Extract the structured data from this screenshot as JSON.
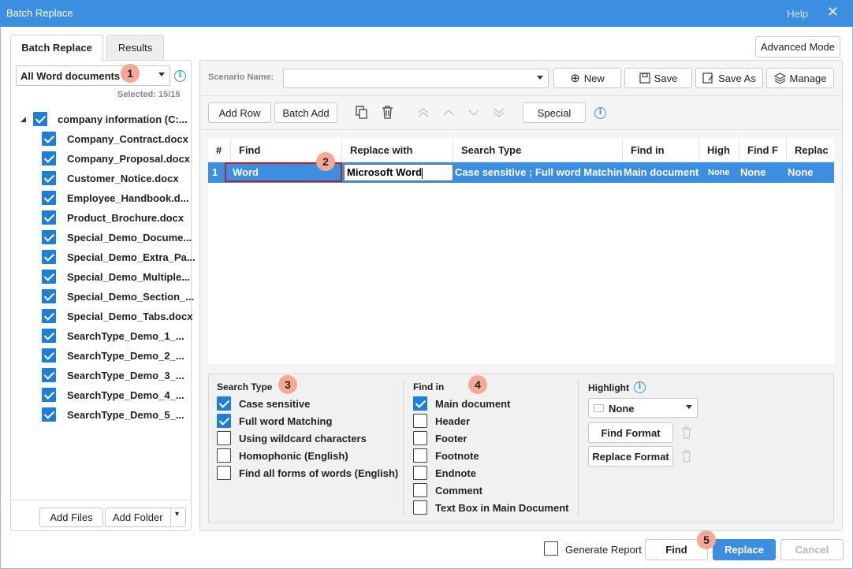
{
  "window": {
    "title": "Batch Replace",
    "help": "Help",
    "close": "✕"
  },
  "tabs": [
    {
      "label": "Batch Replace"
    },
    {
      "label": "Results"
    }
  ],
  "advanced_mode": "Advanced Mode",
  "left": {
    "filter": "All Word documents",
    "selected": "Selected: 15/15",
    "root": "company information (C:...",
    "files": [
      "Company_Contract.docx",
      "Company_Proposal.docx",
      "Customer_Notice.docx",
      "Employee_Handbook.d...",
      "Product_Brochure.docx",
      "Special_Demo_Docume...",
      "Special_Demo_Extra_Pa...",
      "Special_Demo_Multiple...",
      "Special_Demo_Section_...",
      "Special_Demo_Tabs.docx",
      "SearchType_Demo_1_...",
      "SearchType_Demo_2_...",
      "SearchType_Demo_3_...",
      "SearchType_Demo_4_...",
      "SearchType_Demo_5_..."
    ],
    "add_files": "Add Files",
    "add_folder": "Add Folder"
  },
  "scenario": {
    "label": "Scenario Name:",
    "value": "",
    "new": "New",
    "save": "Save",
    "save_as": "Save As",
    "manage": "Manage"
  },
  "toolbar": {
    "add_row": "Add Row",
    "batch_add": "Batch Add",
    "special": "Special"
  },
  "grid": {
    "headers": [
      "#",
      "Find",
      "Replace with",
      "Search Type",
      "Find in",
      "High",
      "Find F",
      "Replac"
    ],
    "row": {
      "num": "1",
      "find": "Word",
      "replace": "Microsoft Word",
      "search_type": "Case sensitive ; Full word Matching",
      "find_in": "Main document",
      "high": "None",
      "find_format": "None",
      "replace_format": "None"
    }
  },
  "search_type": {
    "title": "Search Type",
    "options": [
      {
        "label": "Case sensitive",
        "checked": true
      },
      {
        "label": "Full word Matching",
        "checked": true
      },
      {
        "label": "Using wildcard characters",
        "checked": false
      },
      {
        "label": "Homophonic (English)",
        "checked": false
      },
      {
        "label": "Find all forms of words (English)",
        "checked": false
      }
    ]
  },
  "find_in": {
    "title": "Find in",
    "options": [
      {
        "label": "Main document",
        "checked": true
      },
      {
        "label": "Header",
        "checked": false
      },
      {
        "label": "Footer",
        "checked": false
      },
      {
        "label": "Footnote",
        "checked": false
      },
      {
        "label": "Endnote",
        "checked": false
      },
      {
        "label": "Comment",
        "checked": false
      },
      {
        "label": "Text Box in Main Document",
        "checked": false
      }
    ]
  },
  "highlight": {
    "title": "Highlight",
    "value": "None",
    "find_format": "Find Format",
    "replace_format": "Replace Format"
  },
  "footer": {
    "generate_report": "Generate Report",
    "find": "Find",
    "replace": "Replace",
    "cancel": "Cancel"
  },
  "badges": [
    "1",
    "2",
    "3",
    "4",
    "5"
  ],
  "colors": {
    "accent": "#3c8ee0",
    "badge": "#f4a996",
    "checkbox": "#1f7fd8"
  }
}
